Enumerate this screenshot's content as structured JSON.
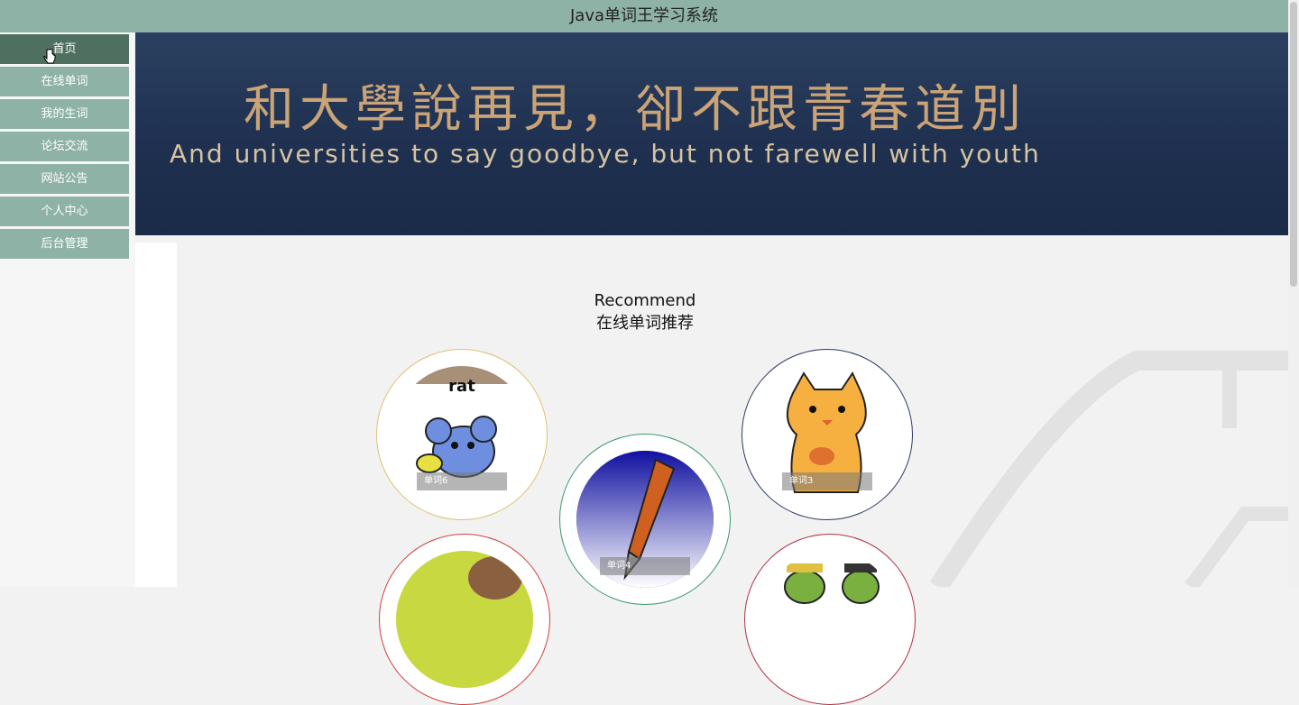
{
  "header": {
    "title": "Java单词王学习系统"
  },
  "sidebar": {
    "items": [
      {
        "label": "首页"
      },
      {
        "label": "在线单词"
      },
      {
        "label": "我的生词"
      },
      {
        "label": "论坛交流"
      },
      {
        "label": "网站公告"
      },
      {
        "label": "个人中心"
      },
      {
        "label": "后台管理"
      }
    ]
  },
  "banner": {
    "cn_text": "和大學說再見，卻不跟青春道別",
    "en_text": "And universities to say goodbye, but not farewell with youth"
  },
  "recommend": {
    "title_en": "Recommend",
    "title_cn": "在线单词推荐",
    "cards": [
      {
        "caption": "单词6",
        "image_text": "rat"
      },
      {
        "caption": "单词4"
      },
      {
        "caption": "单词3"
      }
    ]
  },
  "colors": {
    "accent": "#8fb2a7",
    "active": "#4f6f61"
  }
}
